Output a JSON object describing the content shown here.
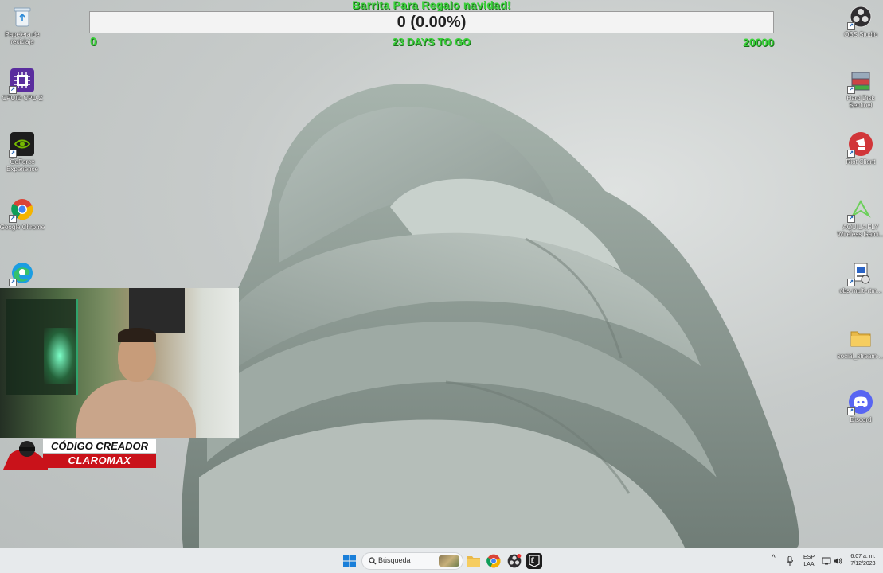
{
  "goal": {
    "title": "Barrita Para Regalo navidad!",
    "value_text": "0 (0.00%)",
    "progress_fraction": 0.0,
    "min": "0",
    "days_left": "23 DAYS TO GO",
    "max": "20000",
    "accent_color": "#3bd23b"
  },
  "desktop_left": [
    {
      "label": "Papelera de reciclaje",
      "icon": "recycle-bin-icon"
    },
    {
      "label": "CPUID CPU-Z",
      "icon": "cpu-z-icon"
    },
    {
      "label": "GeForce Experience",
      "icon": "nvidia-icon"
    },
    {
      "label": "Google Chrome",
      "icon": "chrome-icon"
    },
    {
      "label": "",
      "icon": "edge-icon"
    }
  ],
  "desktop_right": [
    {
      "label": "OBS Studio",
      "icon": "obs-icon"
    },
    {
      "label": "Hard Disk Sentinel",
      "icon": "hard-disk-icon"
    },
    {
      "label": "Riot Client",
      "icon": "riot-icon"
    },
    {
      "label": "AQUILA FLY Wireless Gami...",
      "icon": "aquila-icon"
    },
    {
      "label": "obs-multi-rtm...",
      "icon": "installer-icon"
    },
    {
      "label": "social_stream-...",
      "icon": "folder-icon"
    },
    {
      "label": "Discord",
      "icon": "discord-icon"
    }
  ],
  "creator_banner": {
    "top": "CÓDIGO CREADOR",
    "bottom": "CLAROMAX"
  },
  "taskbar": {
    "search_placeholder": "Búsqueda",
    "lang_top": "ESP",
    "lang_bottom": "LAA",
    "time": "6:07 a. m.",
    "date": "7/12/2023",
    "chevron": "^"
  }
}
